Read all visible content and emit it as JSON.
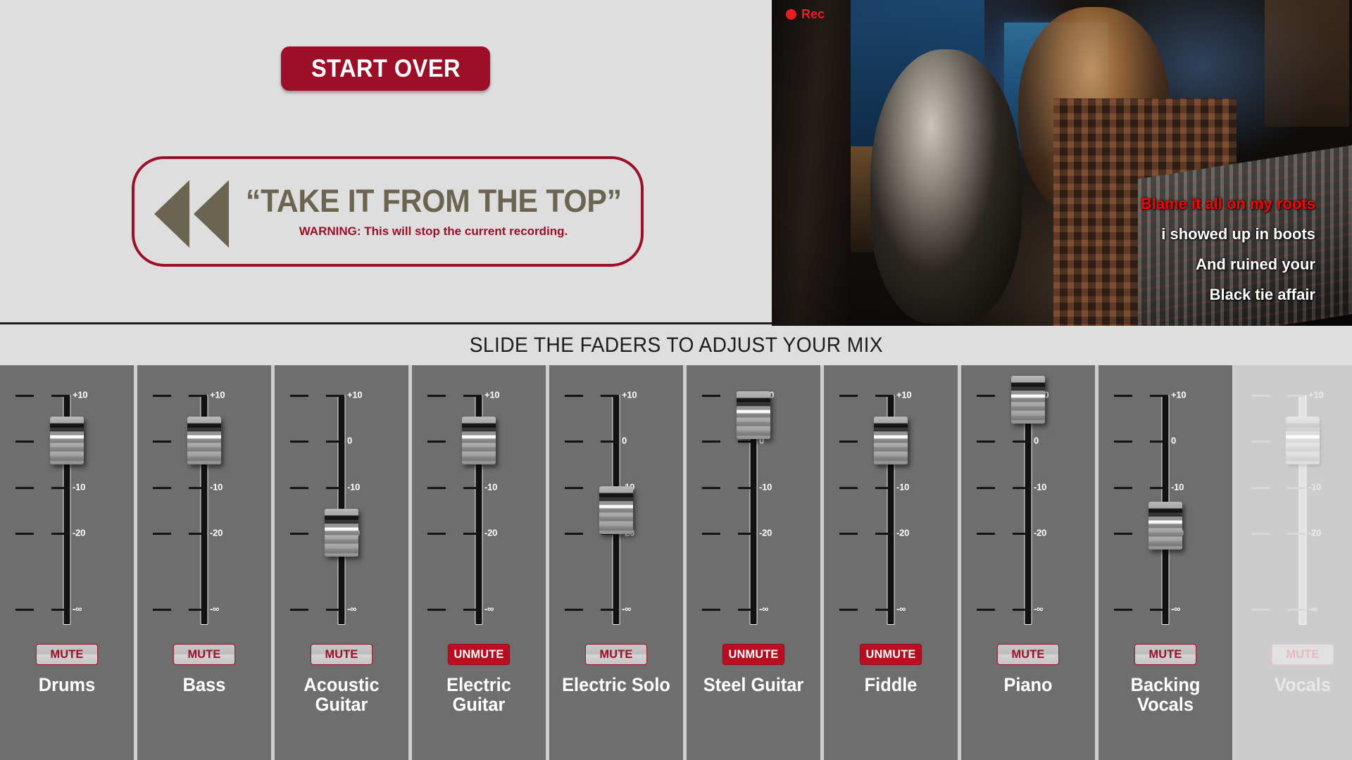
{
  "start_over": {
    "label": "START OVER"
  },
  "take_it_from_the_top": {
    "icon": "rewind-icon",
    "title": "“TAKE IT FROM THE TOP”",
    "warning": "WARNING: This will stop the current recording."
  },
  "video": {
    "rec_indicator": {
      "icon": "record-dot-icon",
      "label": "Rec"
    },
    "lyrics": [
      {
        "text": "Blame it all on my roots",
        "state": "active"
      },
      {
        "text": "i showed up in boots",
        "state": "upcoming"
      },
      {
        "text": "And ruined your",
        "state": "upcoming"
      },
      {
        "text": "Black tie affair",
        "state": "upcoming"
      }
    ]
  },
  "instruction": {
    "text": "SLIDE THE FADERS TO ADJUST YOUR MIX"
  },
  "mixer": {
    "scale_labels": [
      "+10",
      "0",
      "-10",
      "-20",
      "-∞"
    ],
    "scale_positions_pct": [
      0,
      20,
      40,
      60,
      93
    ],
    "channels": [
      {
        "name": "Drums",
        "value_db": 0,
        "knob_pct": 20,
        "mute_label": "MUTE",
        "muted": false,
        "disabled": false
      },
      {
        "name": "Bass",
        "value_db": 0,
        "knob_pct": 20,
        "mute_label": "MUTE",
        "muted": false,
        "disabled": false
      },
      {
        "name": "Acoustic Guitar",
        "value_db": -20,
        "knob_pct": 60,
        "mute_label": "MUTE",
        "muted": false,
        "disabled": false
      },
      {
        "name": "Electric Guitar",
        "value_db": 0,
        "knob_pct": 20,
        "mute_label": "UNMUTE",
        "muted": true,
        "disabled": false
      },
      {
        "name": "Electric Solo",
        "value_db": -15,
        "knob_pct": 50,
        "mute_label": "MUTE",
        "muted": false,
        "disabled": false
      },
      {
        "name": "Steel Guitar",
        "value_db": 5,
        "knob_pct": 9,
        "mute_label": "UNMUTE",
        "muted": true,
        "disabled": false
      },
      {
        "name": "Fiddle",
        "value_db": 0,
        "knob_pct": 20,
        "mute_label": "UNMUTE",
        "muted": true,
        "disabled": false
      },
      {
        "name": "Piano",
        "value_db": 10,
        "knob_pct": 2,
        "mute_label": "MUTE",
        "muted": false,
        "disabled": false
      },
      {
        "name": "Backing Vocals",
        "value_db": -18,
        "knob_pct": 57,
        "mute_label": "MUTE",
        "muted": false,
        "disabled": false
      },
      {
        "name": "Vocals",
        "value_db": 0,
        "knob_pct": 20,
        "mute_label": "MUTE",
        "muted": false,
        "disabled": true
      }
    ]
  },
  "colors": {
    "brand_red": "#9c0f26",
    "mute_active_red": "#c70d23",
    "olive": "#6b6450",
    "panel_bg": "#dedede",
    "channel_bg": "#6e6e6e",
    "lyric_active": "#ff0000",
    "rec_red": "#ed1c24"
  }
}
